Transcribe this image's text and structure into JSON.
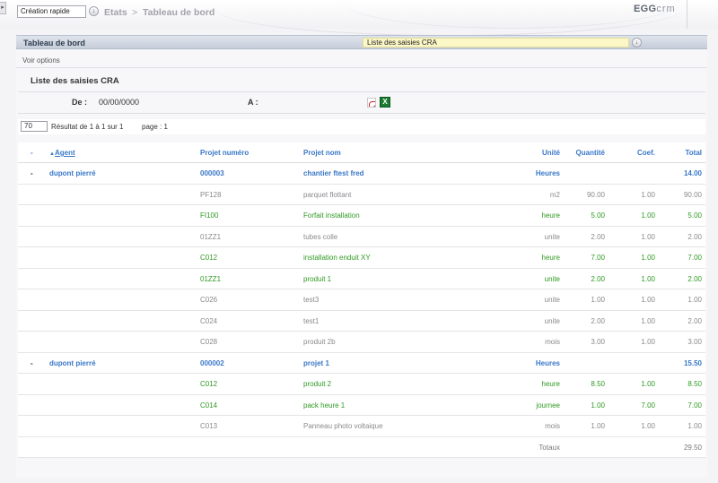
{
  "topbar": {
    "left_tab_icon": "arrow-right-icon",
    "quick_create": "Création rapide",
    "dropdown_icon": "arrow-down-icon",
    "breadcrumb": [
      "Etats",
      ">",
      "Tableau de bord"
    ],
    "logo_main": "EGG",
    "logo_suffix": "crm"
  },
  "panel": {
    "title": "Tableau de bord",
    "report_select": "Liste des saisies CRA",
    "voir_options": "Voir options",
    "report_title": "Liste des saisies CRA",
    "filter_from_label": "De :",
    "filter_from_value": "00/00/0000",
    "filter_to_label": "A :",
    "export_icons": [
      "pdf-icon",
      "excel-icon"
    ]
  },
  "pager": {
    "page_size": "70",
    "result_text": "Résultat de 1 à 1 sur 1",
    "page_text": "page : 1"
  },
  "table": {
    "headers": {
      "toggle": "-",
      "agent": "Agent",
      "num": "Projet numéro",
      "nom": "Projet nom",
      "unit": "Unité",
      "qte": "Quantité",
      "coef": "Coef.",
      "total": "Total"
    },
    "rows": [
      {
        "type": "agent",
        "toggle": "-",
        "agent": "dupont pierré",
        "num": "000003",
        "nom": "chantier ftest fred",
        "unit": "Heures",
        "qte": "",
        "coef": "",
        "total": "14.00"
      },
      {
        "type": "grey",
        "toggle": "",
        "agent": "",
        "num": "PF128",
        "nom": "parquet flottant",
        "unit": "m2",
        "qte": "90.00",
        "coef": "1.00",
        "total": "90.00"
      },
      {
        "type": "green",
        "toggle": "",
        "agent": "",
        "num": "FI100",
        "nom": "Forfait installation",
        "unit": "heure",
        "qte": "5.00",
        "coef": "1.00",
        "total": "5.00"
      },
      {
        "type": "grey",
        "toggle": "",
        "agent": "",
        "num": "01ZZ1",
        "nom": "tubes colle",
        "unit": "unite",
        "qte": "2.00",
        "coef": "1.00",
        "total": "2.00"
      },
      {
        "type": "green",
        "toggle": "",
        "agent": "",
        "num": "C012",
        "nom": "installation enduit XY",
        "unit": "heure",
        "qte": "7.00",
        "coef": "1.00",
        "total": "7.00"
      },
      {
        "type": "green",
        "toggle": "",
        "agent": "",
        "num": "01ZZ1",
        "nom": "produit 1",
        "unit": "unite",
        "qte": "2.00",
        "coef": "1.00",
        "total": "2.00"
      },
      {
        "type": "grey",
        "toggle": "",
        "agent": "",
        "num": "C026",
        "nom": "test3",
        "unit": "unite",
        "qte": "1.00",
        "coef": "1.00",
        "total": "1.00"
      },
      {
        "type": "grey",
        "toggle": "",
        "agent": "",
        "num": "C024",
        "nom": "test1",
        "unit": "unite",
        "qte": "2.00",
        "coef": "1.00",
        "total": "2.00"
      },
      {
        "type": "grey",
        "toggle": "",
        "agent": "",
        "num": "C028",
        "nom": "produit 2b",
        "unit": "mois",
        "qte": "3.00",
        "coef": "1.00",
        "total": "3.00"
      },
      {
        "type": "agent",
        "toggle": "-",
        "agent": "dupont pierré",
        "num": "000002",
        "nom": "projet 1",
        "unit": "Heures",
        "qte": "",
        "coef": "",
        "total": "15.50"
      },
      {
        "type": "green",
        "toggle": "",
        "agent": "",
        "num": "C012",
        "nom": "produit 2",
        "unit": "heure",
        "qte": "8.50",
        "coef": "1.00",
        "total": "8.50"
      },
      {
        "type": "green",
        "toggle": "",
        "agent": "",
        "num": "C014",
        "nom": "pack heure 1",
        "unit": "journee",
        "qte": "1.00",
        "coef": "7.00",
        "total": "7.00"
      },
      {
        "type": "grey",
        "toggle": "",
        "agent": "",
        "num": "C013",
        "nom": "Panneau photo voltaique",
        "unit": "mois",
        "qte": "1.00",
        "coef": "1.00",
        "total": "1.00"
      }
    ],
    "totals_label": "Totaux",
    "totals_value": "29.50"
  }
}
